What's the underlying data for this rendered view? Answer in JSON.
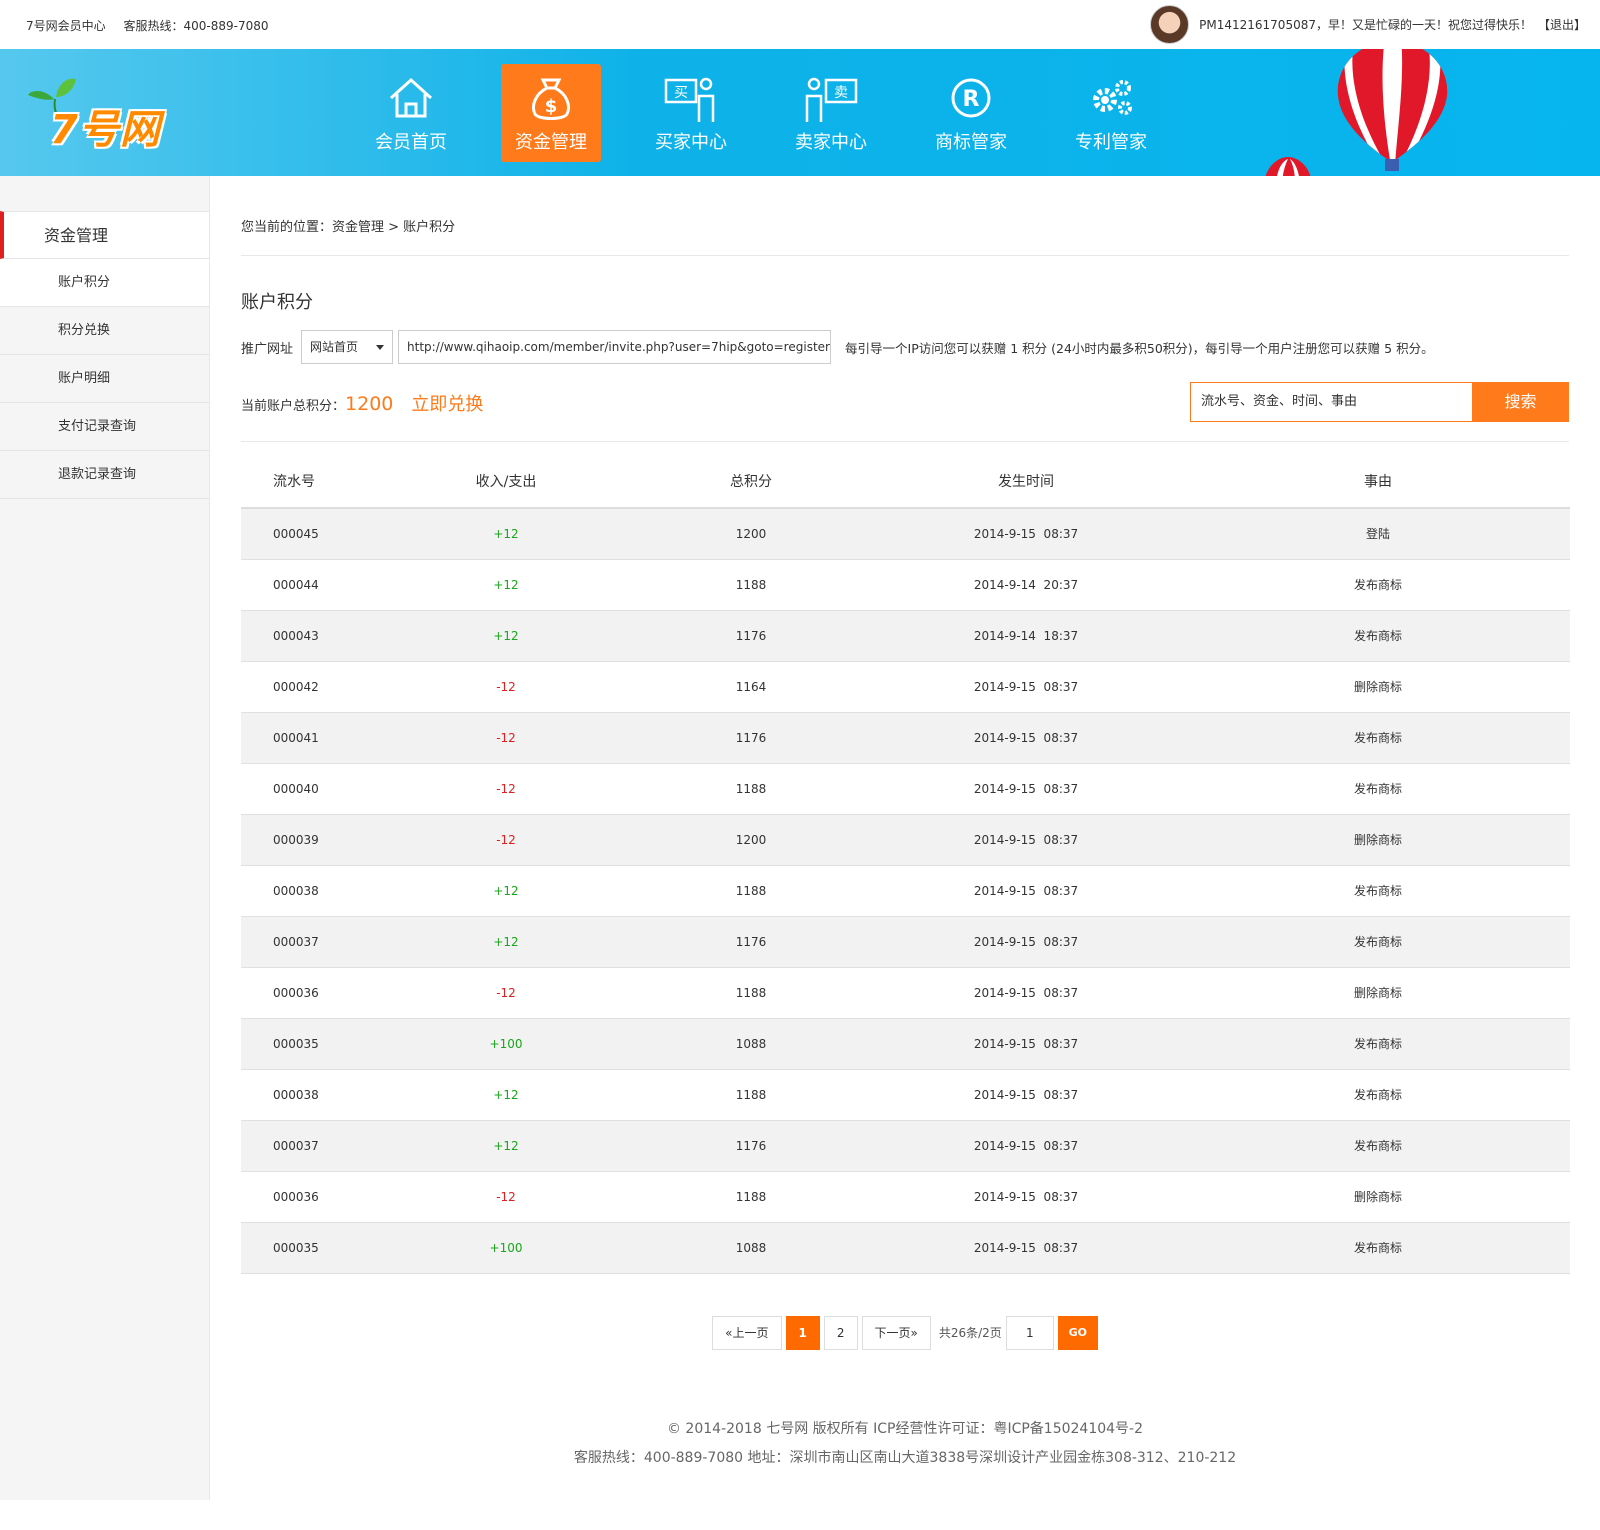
{
  "topbar": {
    "site_name": "7号网会员中心",
    "hotline": "客服热线：400-889-7080",
    "greeting": "PM1412161705087，早！又是忙碌的一天！祝您过得快乐！",
    "logout": "【退出】"
  },
  "logo": {
    "text": "7号网"
  },
  "nav": [
    {
      "label": "会员首页",
      "icon": "home-icon"
    },
    {
      "label": "资金管理",
      "icon": "money-bag-icon",
      "active": true
    },
    {
      "label": "买家中心",
      "icon": "buyer-icon",
      "badge": "买"
    },
    {
      "label": "卖家中心",
      "icon": "seller-icon",
      "badge": "卖"
    },
    {
      "label": "商标管家",
      "icon": "registered-icon"
    },
    {
      "label": "专利管家",
      "icon": "gears-icon"
    }
  ],
  "sidebar": {
    "heading": "资金管理",
    "items": [
      "账户积分",
      "积分兑换",
      "账户明细",
      "支付记录查询",
      "退款记录查询"
    ]
  },
  "breadcrumb": "您当前的位置：资金管理 > 账户积分",
  "page_title": "账户积分",
  "promo": {
    "label": "推广网址",
    "select_value": "网站首页",
    "url": "http://www.qihaoip.com/member/invite.php?user=7hip&goto=register",
    "tip": "每引导一个IP访问您可以获赠 1 积分 (24小时内最多积50积分)，每引导一个用户注册您可以获赠 5 积分。"
  },
  "points": {
    "label": "当前账户总积分：",
    "value": "1200",
    "exchange": "立即兑换"
  },
  "search": {
    "placeholder": "流水号、资金、时间、事由",
    "button": "搜索"
  },
  "table": {
    "headers": [
      "流水号",
      "收入/支出",
      "总积分",
      "发生时间",
      "事由"
    ],
    "rows": [
      [
        "000045",
        "+12",
        "1200",
        "2014-9-15  08:37",
        "登陆"
      ],
      [
        "000044",
        "+12",
        "1188",
        "2014-9-14  20:37",
        "发布商标"
      ],
      [
        "000043",
        "+12",
        "1176",
        "2014-9-14  18:37",
        "发布商标"
      ],
      [
        "000042",
        "-12",
        "1164",
        "2014-9-15  08:37",
        "删除商标"
      ],
      [
        "000041",
        "-12",
        "1176",
        "2014-9-15  08:37",
        "发布商标"
      ],
      [
        "000040",
        "-12",
        "1188",
        "2014-9-15  08:37",
        "发布商标"
      ],
      [
        "000039",
        "-12",
        "1200",
        "2014-9-15  08:37",
        "删除商标"
      ],
      [
        "000038",
        "+12",
        "1188",
        "2014-9-15  08:37",
        "发布商标"
      ],
      [
        "000037",
        "+12",
        "1176",
        "2014-9-15  08:37",
        "发布商标"
      ],
      [
        "000036",
        "-12",
        "1188",
        "2014-9-15  08:37",
        "删除商标"
      ],
      [
        "000035",
        "+100",
        "1088",
        "2014-9-15  08:37",
        "发布商标"
      ],
      [
        "000038",
        "+12",
        "1188",
        "2014-9-15  08:37",
        "发布商标"
      ],
      [
        "000037",
        "+12",
        "1176",
        "2014-9-15  08:37",
        "发布商标"
      ],
      [
        "000036",
        "-12",
        "1188",
        "2014-9-15  08:37",
        "删除商标"
      ],
      [
        "000035",
        "+100",
        "1088",
        "2014-9-15  08:37",
        "发布商标"
      ]
    ]
  },
  "pager": {
    "prev": "«上一页",
    "pages": [
      "1",
      "2"
    ],
    "current": "1",
    "next": "下一页»",
    "summary": "共26条/2页",
    "jump_value": "1",
    "go": "GO"
  },
  "footer": {
    "line1": "© 2014-2018 七号网 版权所有 ICP经营性许可证：粤ICP备15024104号-2",
    "line2": "客服热线：400-889-7080  地址：深圳市南山区南山大道3838号深圳设计产业园金栋308-312、210-212"
  },
  "colors": {
    "accent": "#ff7a1a",
    "header_blue": "#0eb2e8",
    "plus": "#1aa61a",
    "minus": "#e02020",
    "active_marker": "#e02020"
  }
}
